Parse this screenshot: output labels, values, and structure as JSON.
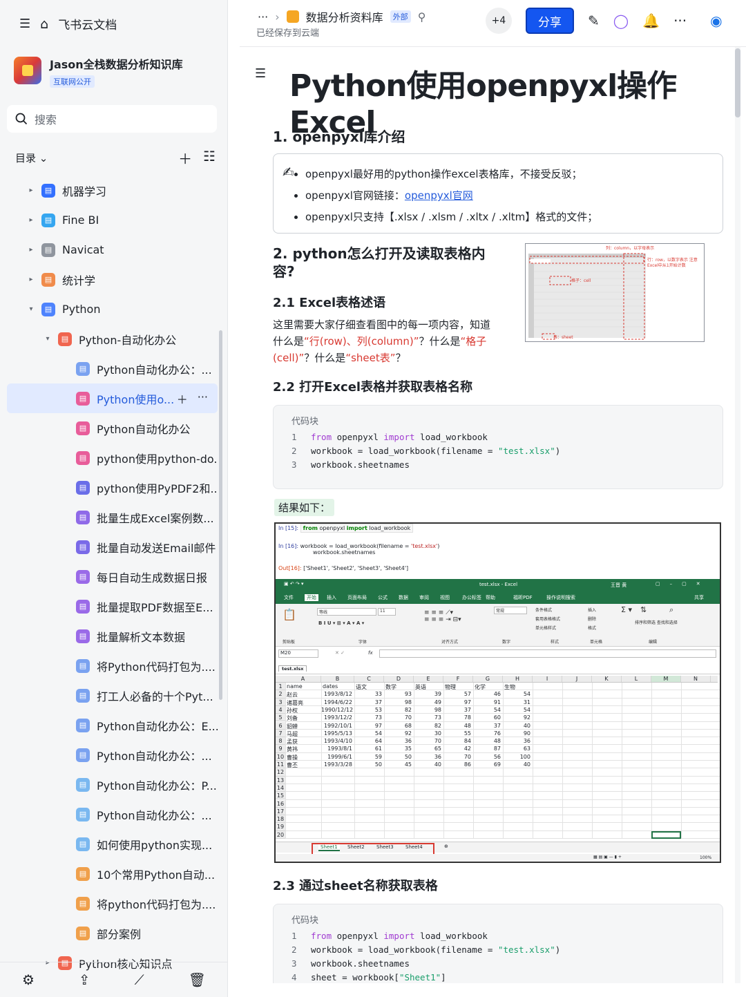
{
  "app": {
    "title": "飞书云文档"
  },
  "kb": {
    "name": "Jason全栈数据分析知识库",
    "badge": "互联网公开"
  },
  "search": {
    "placeholder": "搜索"
  },
  "toc": {
    "label": "目录 ⌄"
  },
  "tree": [
    {
      "label": "机器学习",
      "depth": 0,
      "arrow": "▸",
      "color": "#3370ff",
      "icon": "ml-icon"
    },
    {
      "label": "Fine BI",
      "depth": 0,
      "arrow": "▸",
      "color": "#35a6f0",
      "icon": "globe-icon"
    },
    {
      "label": "Navicat",
      "depth": 0,
      "arrow": "▸",
      "color": "#8f959e",
      "icon": "gear-icon"
    },
    {
      "label": "统计学",
      "depth": 0,
      "arrow": "▸",
      "color": "#f08b4b",
      "icon": "book-icon"
    },
    {
      "label": "Python",
      "depth": 0,
      "arrow": "▾",
      "color": "#4e83fd",
      "icon": "folder-icon"
    },
    {
      "label": "Python-自动化办公",
      "depth": 1,
      "arrow": "▾",
      "color": "#f0654f",
      "icon": "doc-icon"
    },
    {
      "label": "Python自动化办公：...",
      "depth": 2,
      "arrow": "",
      "color": "#7aa2f0",
      "icon": "doc-icon"
    },
    {
      "label": "Python使用o...",
      "depth": 2,
      "arrow": "",
      "color": "#e85d9a",
      "icon": "doc-icon",
      "active": true
    },
    {
      "label": "Python自动化办公",
      "depth": 2,
      "arrow": "",
      "color": "#e85d9a",
      "icon": "doc-icon"
    },
    {
      "label": "python使用python-do...",
      "depth": 2,
      "arrow": "",
      "color": "#e85d9a",
      "icon": "doc-icon"
    },
    {
      "label": "python使用PyPDF2和...",
      "depth": 2,
      "arrow": "",
      "color": "#6a6ee8",
      "icon": "doc-icon"
    },
    {
      "label": "批量生成Excel案例数...",
      "depth": 2,
      "arrow": "",
      "color": "#8f6ae8",
      "icon": "doc-icon"
    },
    {
      "label": "批量自动发送Email邮件",
      "depth": 2,
      "arrow": "",
      "color": "#7a6ae8",
      "icon": "doc-icon"
    },
    {
      "label": "每日自动生成数据日报",
      "depth": 2,
      "arrow": "",
      "color": "#9a6ae8",
      "icon": "doc-icon"
    },
    {
      "label": "批量提取PDF数据至E...",
      "depth": 2,
      "arrow": "",
      "color": "#9a6ae8",
      "icon": "doc-icon"
    },
    {
      "label": "批量解析文本数据",
      "depth": 2,
      "arrow": "",
      "color": "#9a6ae8",
      "icon": "doc-icon"
    },
    {
      "label": "将Python代码打包为....",
      "depth": 2,
      "arrow": "",
      "color": "#7aa2f0",
      "icon": "doc-icon"
    },
    {
      "label": "打工人必备的十个Pyt...",
      "depth": 2,
      "arrow": "",
      "color": "#7aa2f0",
      "icon": "doc-icon"
    },
    {
      "label": "Python自动化办公：E...",
      "depth": 2,
      "arrow": "",
      "color": "#7aa2f0",
      "icon": "doc-icon"
    },
    {
      "label": "Python自动化办公：...",
      "depth": 2,
      "arrow": "",
      "color": "#7aa2f0",
      "icon": "doc-icon"
    },
    {
      "label": "Python自动化办公：P...",
      "depth": 2,
      "arrow": "",
      "color": "#7ab8f0",
      "icon": "doc-icon"
    },
    {
      "label": "Python自动化办公：...",
      "depth": 2,
      "arrow": "",
      "color": "#7ab8f0",
      "icon": "doc-icon"
    },
    {
      "label": "如何使用python实现...",
      "depth": 2,
      "arrow": "",
      "color": "#7ab8f0",
      "icon": "doc-icon"
    },
    {
      "label": "10个常用Python自动...",
      "depth": 2,
      "arrow": "",
      "color": "#f0a04b",
      "icon": "doc-icon"
    },
    {
      "label": "将python代码打包为....",
      "depth": 2,
      "arrow": "",
      "color": "#f0a04b",
      "icon": "doc-icon"
    },
    {
      "label": "部分案例",
      "depth": 2,
      "arrow": "",
      "color": "#f0a04b",
      "icon": "doc-icon"
    },
    {
      "label": "Python核心知识点",
      "depth": 1,
      "arrow": "▸",
      "color": "#f0654f",
      "icon": "doc-icon"
    }
  ],
  "header": {
    "more": "···",
    "sep": "›",
    "library": "数据分析资料库",
    "external": "外部",
    "saved": "已经保存到云端",
    "collab": "+4",
    "share": "分享"
  },
  "doc": {
    "title": "Python使用openpyxl操作Excel",
    "h1": "1. openpyxl库介绍",
    "bullets": {
      "b1": "openpyxl最好用的python操作excel表格库，不接受反驳；",
      "b2pre": "openpyxl官网链接：",
      "b2link": "openpyxl官网",
      "b3": "openpyxl只支持【.xlsx / .xlsm / .xltx / .xltm】格式的文件；"
    },
    "h2": "2. python怎么打开及读取表格内容?",
    "h21": "2.1 Excel表格述语",
    "p1a": "这里需要大家仔细查看图中的每一项内容，知道什么是",
    "p1b": "“行(row)、列(column)”",
    "p1c": "？什么是",
    "p1d": "“格子(cell)”",
    "p1e": "？什么是",
    "p1f": "“sheet表”",
    "p1g": "？",
    "h22": "2.2 打开Excel表格并获取表格名称",
    "code_label": "代码块",
    "code1": [
      {
        "n": "1",
        "pre": "",
        "kw1": "from",
        "mid": " openpyxl ",
        "kw2": "import",
        "post": " load_workbook",
        "str": "",
        "end": ""
      },
      {
        "n": "2",
        "pre": "workbook = load_workbook(filename = ",
        "kw1": "",
        "mid": "",
        "kw2": "",
        "post": "",
        "str": "\"test.xlsx\"",
        "end": ")"
      },
      {
        "n": "3",
        "pre": "workbook.sheetnames",
        "kw1": "",
        "mid": "",
        "kw2": "",
        "post": "",
        "str": "",
        "end": ""
      }
    ],
    "result": "结果如下：",
    "h23": "2.3 通过sheet名称获取表格",
    "code2": [
      {
        "n": "1",
        "pre": "",
        "kw1": "from",
        "mid": " openpyxl ",
        "kw2": "import",
        "post": " load_workbook",
        "str": "",
        "end": ""
      },
      {
        "n": "2",
        "pre": "workbook = load_workbook(filename = ",
        "kw1": "",
        "mid": "",
        "kw2": "",
        "post": "",
        "str": "\"test.xlsx\"",
        "end": ")"
      },
      {
        "n": "3",
        "pre": "workbook.sheetnames",
        "kw1": "",
        "mid": "",
        "kw2": "",
        "post": "",
        "str": "",
        "end": ""
      },
      {
        "n": "4",
        "pre": "sheet = workbook[",
        "kw1": "",
        "mid": "",
        "kw2": "",
        "post": "",
        "str": "\"Sheet1\"",
        "end": "]"
      }
    ]
  },
  "figure": {
    "col": "列：column，以字母表示",
    "row": "行：row，以数字表示 注意Excel中从1开始计数",
    "cell": "格子：cell",
    "sheet": "表：sheet"
  },
  "excel": {
    "in15": "In  [15]:",
    "code15a": "from",
    "code15b": " openpyxl ",
    "code15c": "import",
    "code15d": " load_workbook",
    "in16": "In  [16]:",
    "code16a": "workbook = load_workbook(filename = ",
    "code16b": "'test.xlsx'",
    "code16c": ")",
    "code16d": "workbook.sheetnames",
    "out16": "Out[16]:",
    "out16v": "['Sheet1', 'Sheet2', 'Sheet3', 'Sheet4']",
    "title": "test.xlsx - Excel",
    "user": "王晋 黄",
    "menu": [
      "文件",
      "开始",
      "插入",
      "页面布局",
      "公式",
      "数据",
      "审阅",
      "视图",
      "办公标签",
      "帮助",
      "福昕PDF",
      "操作说明搜索"
    ],
    "menu_share": "共享",
    "groups": [
      "剪贴板",
      "字体",
      "对齐方式",
      "数字",
      "样式",
      "单元格",
      "编辑"
    ],
    "font": "等线",
    "size": "11",
    "numfmt": "常规",
    "cf": [
      "条件格式",
      "套用表格格式",
      "单元格样式"
    ],
    "cells": [
      "插入",
      "删除",
      "格式"
    ],
    "edit": "排序和筛选 查找和选择",
    "namebox": "M20",
    "fx": "fx",
    "filetab": "test.xlsx",
    "cols": [
      "A",
      "B",
      "C",
      "D",
      "E",
      "F",
      "G",
      "H",
      "I",
      "J",
      "K",
      "L",
      "M",
      "N"
    ],
    "headers": [
      "name",
      "dates",
      "语文",
      "数学",
      "英语",
      "物理",
      "化学",
      "生物"
    ],
    "rows": [
      [
        "赵云",
        "1993/8/12",
        "33",
        "93",
        "39",
        "57",
        "46",
        "54"
      ],
      [
        "诸葛亮",
        "1994/6/22",
        "37",
        "98",
        "49",
        "97",
        "91",
        "31"
      ],
      [
        "孙权",
        "1990/12/12",
        "53",
        "82",
        "98",
        "37",
        "54",
        "54"
      ],
      [
        "刘备",
        "1993/12/2",
        "73",
        "70",
        "73",
        "78",
        "60",
        "92"
      ],
      [
        "貂蝉",
        "1992/10/1",
        "97",
        "68",
        "82",
        "48",
        "37",
        "40"
      ],
      [
        "马超",
        "1995/5/13",
        "54",
        "92",
        "30",
        "55",
        "76",
        "90"
      ],
      [
        "孟获",
        "1993/4/10",
        "64",
        "36",
        "70",
        "84",
        "48",
        "36"
      ],
      [
        "黄祎",
        "1993/8/1",
        "61",
        "35",
        "65",
        "42",
        "87",
        "63"
      ],
      [
        "曹操",
        "1999/6/1",
        "59",
        "50",
        "36",
        "70",
        "56",
        "100"
      ],
      [
        "曹丕",
        "1993/3/28",
        "50",
        "45",
        "40",
        "86",
        "69",
        "40"
      ]
    ],
    "sheets": [
      "Sheet1",
      "Sheet2",
      "Sheet3",
      "Sheet4"
    ],
    "zoom": "100%"
  }
}
